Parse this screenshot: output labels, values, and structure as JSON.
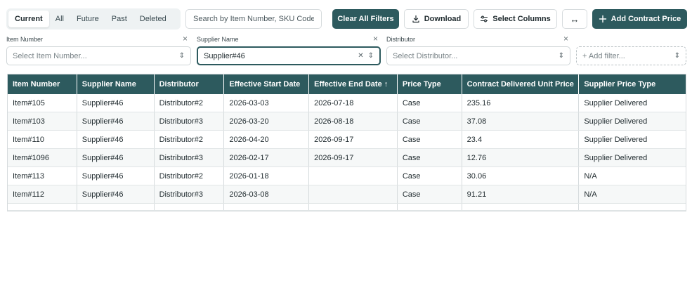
{
  "tabs": [
    "Current",
    "All",
    "Future",
    "Past",
    "Deleted"
  ],
  "active_tab": "Current",
  "search": {
    "placeholder": "Search by Item Number, SKU Code..."
  },
  "toolbar": {
    "clear_filters": "Clear All Filters",
    "download": "Download",
    "select_columns": "Select Columns",
    "expand_icon": "↔",
    "add_contract_price": "Add Contract Price"
  },
  "filters": {
    "item_number": {
      "label": "Item Number",
      "placeholder": "Select Item Number..."
    },
    "supplier_name": {
      "label": "Supplier Name",
      "value": "Supplier#46"
    },
    "distributor": {
      "label": "Distributor",
      "placeholder": "Select Distributor..."
    },
    "add_filter": "+ Add filter..."
  },
  "table": {
    "columns": [
      "Item Number",
      "Supplier Name",
      "Distributor",
      "Effective Start Date",
      "Effective End Date ↑",
      "Price Type",
      "Contract Delivered Unit Price",
      "Supplier Price Type"
    ],
    "rows": [
      [
        "Item#105",
        "Supplier#46",
        "Distributor#2",
        "2026-03-03",
        "2026-07-18",
        "Case",
        "235.16",
        "Supplier Delivered"
      ],
      [
        "Item#103",
        "Supplier#46",
        "Distributor#3",
        "2026-03-20",
        "2026-08-18",
        "Case",
        "37.08",
        "Supplier Delivered"
      ],
      [
        "Item#110",
        "Supplier#46",
        "Distributor#2",
        "2026-04-20",
        "2026-09-17",
        "Case",
        "23.4",
        "Supplier Delivered"
      ],
      [
        "Item#1096",
        "Supplier#46",
        "Distributor#3",
        "2026-02-17",
        "2026-09-17",
        "Case",
        "12.76",
        "Supplier Delivered"
      ],
      [
        "Item#113",
        "Supplier#46",
        "Distributor#2",
        "2026-01-18",
        "",
        "Case",
        "30.06",
        "N/A"
      ],
      [
        "Item#112",
        "Supplier#46",
        "Distributor#3",
        "2026-03-08",
        "",
        "Case",
        "91.21",
        "N/A"
      ]
    ]
  },
  "colors": {
    "accent": "#2d5a5e",
    "border": "#d6dbdd",
    "tab_bg": "#eef2f3"
  }
}
